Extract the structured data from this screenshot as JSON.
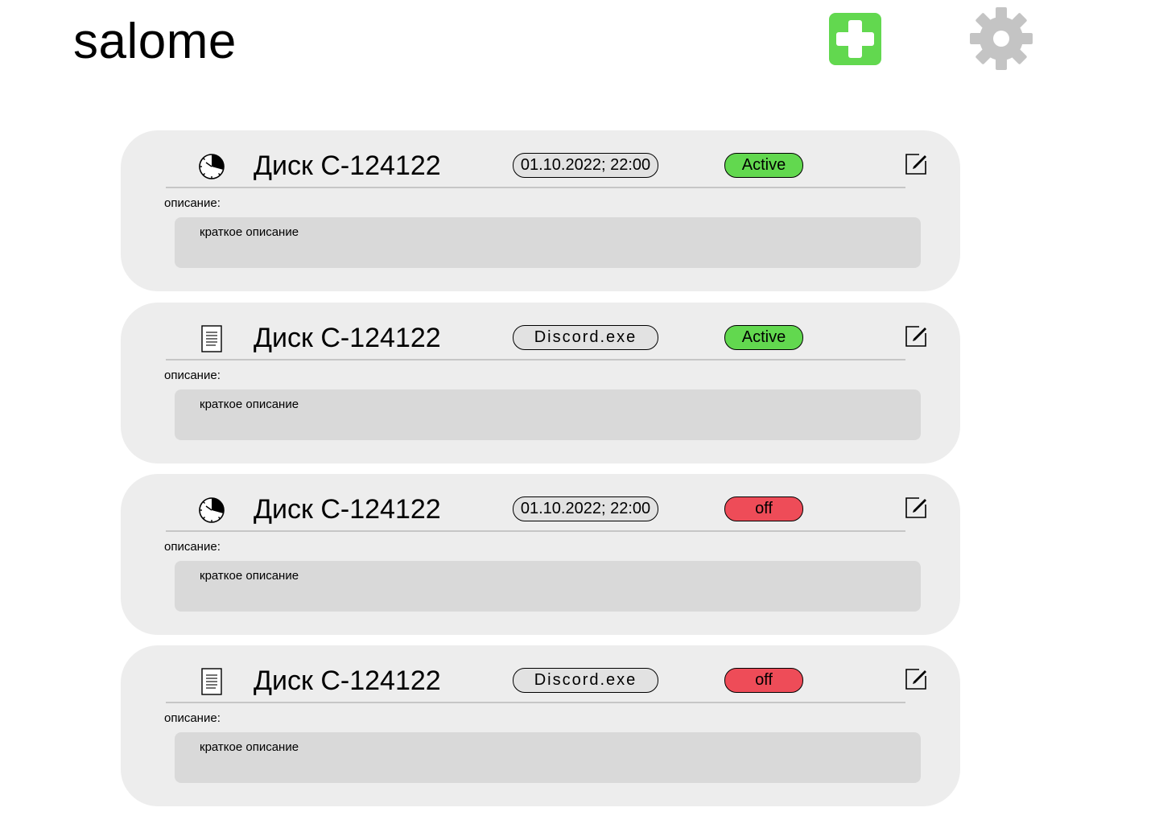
{
  "header": {
    "title": "salome",
    "add_icon": "plus-icon",
    "settings_icon": "gear-icon"
  },
  "colors": {
    "active": "#62d84f",
    "off": "#ee4c58",
    "card": "#ededed",
    "desc_box": "#d9d9d9",
    "settings": "#c4c4c4"
  },
  "tasks": [
    {
      "icon": "clock-icon",
      "title": "Диск C-124122",
      "trigger": "01.10.2022; 22:00",
      "trigger_type": "time",
      "status": "Active",
      "status_state": "active",
      "description_label": "описание:",
      "description": "краткое описание"
    },
    {
      "icon": "document-icon",
      "title": "Диск C-124122",
      "trigger": "Discord.exe",
      "trigger_type": "file",
      "status": "Active",
      "status_state": "active",
      "description_label": "описание:",
      "description": "краткое описание"
    },
    {
      "icon": "clock-icon",
      "title": "Диск C-124122",
      "trigger": "01.10.2022; 22:00",
      "trigger_type": "time",
      "status": "off",
      "status_state": "off",
      "description_label": "описание:",
      "description": "краткое описание"
    },
    {
      "icon": "document-icon",
      "title": "Диск C-124122",
      "trigger": "Discord.exe",
      "trigger_type": "file",
      "status": "off",
      "status_state": "off",
      "description_label": "описание:",
      "description": "краткое описание"
    }
  ]
}
